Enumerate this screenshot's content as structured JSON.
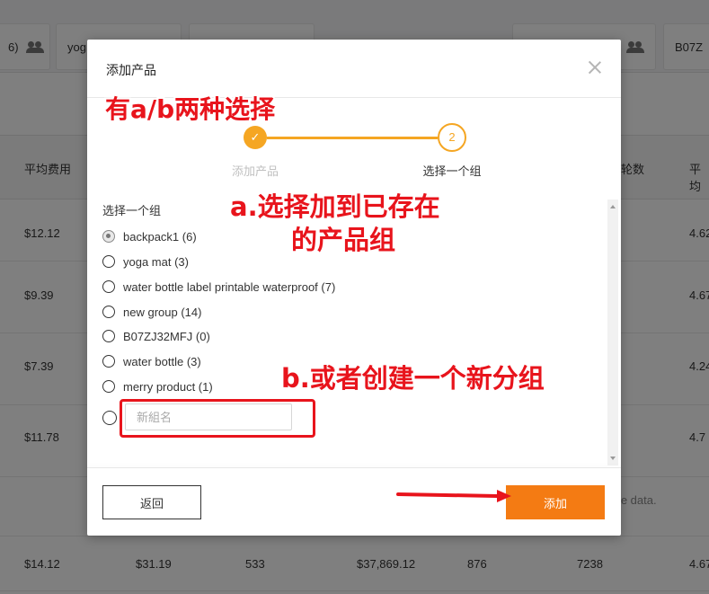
{
  "background": {
    "group_chips": [
      {
        "label": "6)"
      },
      {
        "label": "yog"
      },
      {
        "label": "B07Z"
      }
    ],
    "headers": [
      "平均费用",
      "轮数",
      "平均"
    ],
    "rows": [
      {
        "avg_cost": "$12.12",
        "right": "4.62"
      },
      {
        "avg_cost": "$9.39",
        "right": "4.67"
      },
      {
        "avg_cost": "$7.39",
        "right": "4.24"
      },
      {
        "avg_cost": "$11.78",
        "right": "4.7"
      }
    ],
    "note": "ate data.",
    "bottom_row": [
      "$14.12",
      "$31.19",
      "533",
      "$37,869.12",
      "876",
      "7238",
      "4.67"
    ]
  },
  "modal": {
    "title": "添加产品",
    "steps": [
      {
        "number": "✓",
        "label": "添加产品"
      },
      {
        "number": "2",
        "label": "选择一个组"
      }
    ],
    "select_label": "选择一个组",
    "groups": [
      {
        "label": "backpack1 (6)",
        "checked": true
      },
      {
        "label": "yoga mat (3)",
        "checked": false
      },
      {
        "label": "water bottle label printable waterproof (7)",
        "checked": false
      },
      {
        "label": "new group (14)",
        "checked": false
      },
      {
        "label": "B07ZJ32MFJ (0)",
        "checked": false
      },
      {
        "label": "water bottle (3)",
        "checked": false
      },
      {
        "label": "merry product (1)",
        "checked": false
      }
    ],
    "new_group": {
      "placeholder": "新組名",
      "value": ""
    },
    "back_label": "返回",
    "add_label": "添加"
  },
  "annotations": {
    "choice_note": "有a/b两种选择",
    "option_a_line1": "a.选择加到已存在",
    "option_a_line2": "的产品组",
    "option_b": "b.或者创建一个新分组"
  },
  "colors": {
    "accent": "#f47b13",
    "step": "#f5a623",
    "annotation": "#e8141c"
  }
}
